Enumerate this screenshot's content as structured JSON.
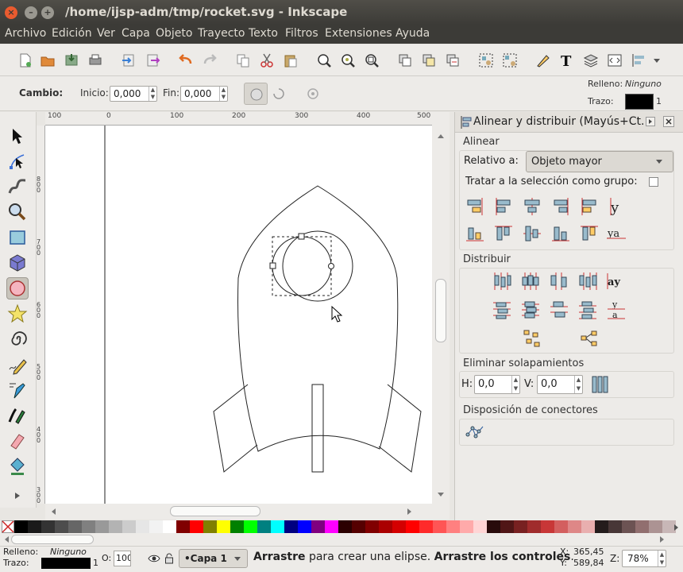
{
  "window": {
    "title": "/home/ijsp-adm/tmp/rocket.svg - Inkscape",
    "buttons": {
      "close": "×",
      "min": "–",
      "max": "+"
    }
  },
  "menu": [
    "Archivo",
    "Edición",
    "Ver",
    "Capa",
    "Objeto",
    "Trayecto",
    "Texto",
    "Filtros",
    "Extensiones",
    "Ayuda"
  ],
  "tool_controls": {
    "mode_label": "Cambio:",
    "start_label": "Inicio:",
    "start_value": "0,000",
    "end_label": "Fin:",
    "end_value": "0,000"
  },
  "style_indicator": {
    "fill_label": "Relleno:",
    "fill_value": "Ninguno",
    "stroke_label": "Trazo:",
    "stroke_width": "1",
    "stroke_color": "#000000"
  },
  "rulers": {
    "h_ticks": [
      "100",
      "0",
      "100",
      "200",
      "300",
      "400",
      "500"
    ],
    "v_ticks": [
      "8\n0\n0",
      "7\n0\n0",
      "6\n0\n0",
      "5\n0\n0",
      "4\n0\n0",
      "3\n0\n0"
    ]
  },
  "dock": {
    "title": "Alinear y distribuir (Mayús+Ct...",
    "align_section": "Alinear",
    "relative_label": "Relativo a:",
    "relative_value": "Objeto mayor",
    "group_label": "Tratar a la selección como grupo:",
    "distribute_section": "Distribuir",
    "overlap_section": "Eliminar solapamientos",
    "h_label": "H:",
    "h_value": "0,0",
    "v_label": "V:",
    "v_value": "0,0",
    "connectors_section": "Disposición de conectores"
  },
  "palette_colors": [
    "#000000",
    "#1a1a1a",
    "#333333",
    "#4d4d4d",
    "#666666",
    "#808080",
    "#999999",
    "#b3b3b3",
    "#cccccc",
    "#e6e6e6",
    "#f2f2f2",
    "#ffffff",
    "#800000",
    "#ff0000",
    "#808000",
    "#ffff00",
    "#008000",
    "#00ff00",
    "#008080",
    "#00ffff",
    "#000080",
    "#0000ff",
    "#800080",
    "#ff00ff",
    "#2b0000",
    "#550000",
    "#800000",
    "#aa0000",
    "#d40000",
    "#ff0000",
    "#ff2a2a",
    "#ff5555",
    "#ff8080",
    "#ffaaaa",
    "#ffd5d5",
    "#280b0b",
    "#501616",
    "#782121",
    "#a02c2c",
    "#c83737",
    "#d35f5f",
    "#de8787",
    "#e9afaf",
    "#241c1c",
    "#483737",
    "#6c5353",
    "#916f6f",
    "#ac9393",
    "#c8b7b7"
  ],
  "status": {
    "fill_label": "Relleno:",
    "fill_value": "Ninguno",
    "stroke_label": "Trazo:",
    "stroke_width": "1",
    "opacity_label": "O:",
    "opacity_value": "100",
    "layer": "•Capa 1",
    "message_bold1": "Arrastre",
    "message_1": " para crear una elipse. ",
    "message_bold2": "Arrastre los controles",
    "message_2": ".",
    "x_label": "X:",
    "x_value": "365,45",
    "y_label": "Y:",
    "y_value": "589,84",
    "zoom_label": "Z:",
    "zoom_value": "78%"
  }
}
